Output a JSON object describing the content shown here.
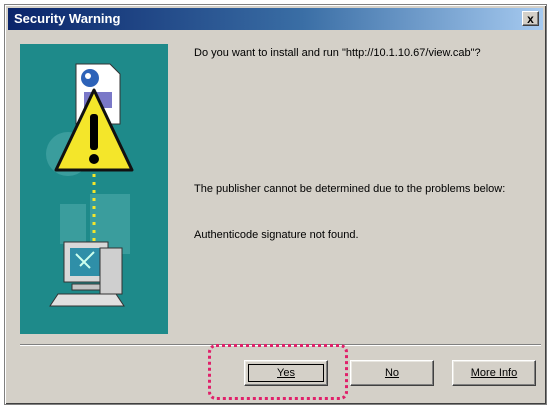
{
  "window": {
    "title": "Security Warning",
    "close_label": "x"
  },
  "messages": {
    "install_question": "Do you want to install and run \"http://10.1.10.67/view.cab\"?",
    "publisher_problem": "The publisher cannot be determined due to the problems below:",
    "authenticode": "Authenticode signature not found."
  },
  "buttons": {
    "yes": "Yes",
    "no": "No",
    "more_info": "More Info"
  },
  "icons": {
    "banner": "security-warning-icon",
    "warning": "warning-triangle-icon",
    "document": "document-icon",
    "computer": "computer-icon"
  },
  "colors": {
    "banner_bg": "#1e8a8a",
    "titlebar_start": "#0a246a",
    "highlight": "#e0206a"
  }
}
